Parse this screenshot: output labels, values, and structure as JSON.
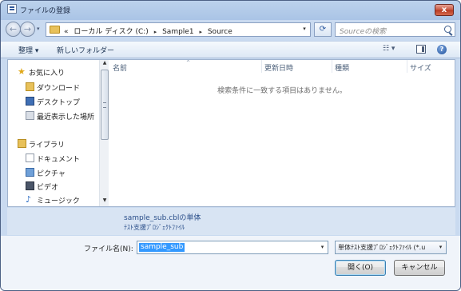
{
  "window": {
    "title": "ファイルの登録",
    "close_glyph": "x"
  },
  "nav": {
    "back_glyph": "←",
    "forward_glyph": "→",
    "dropdown_glyph": "▾",
    "breadcrumb_prefix": "«",
    "breadcrumbs": [
      "ローカル ディスク (C:)",
      "Sample1",
      "Source"
    ],
    "separator_glyph": "▸",
    "refresh_glyph": "⟳",
    "search_placeholder": "Sourceの検索"
  },
  "toolbar": {
    "organize_label": "整理 ▾",
    "new_folder_label": "新しいフォルダー",
    "views_glyph": "☷ ▾",
    "help_glyph": "?"
  },
  "sidebar": {
    "items": [
      {
        "label": "お気に入り",
        "icon": "star-icon"
      },
      {
        "label": "ダウンロード",
        "icon": "downloads-folder-icon"
      },
      {
        "label": "デスクトップ",
        "icon": "desktop-icon"
      },
      {
        "label": "最近表示した場所",
        "icon": "recent-places-icon"
      },
      {
        "label": "ライブラリ",
        "icon": "library-icon"
      },
      {
        "label": "ドキュメント",
        "icon": "documents-icon"
      },
      {
        "label": "ピクチャ",
        "icon": "pictures-icon"
      },
      {
        "label": "ビデオ",
        "icon": "videos-icon"
      },
      {
        "label": "ミュージック",
        "icon": "music-icon"
      }
    ],
    "star_glyph": "★",
    "music_glyph": "♪",
    "scroll_up_glyph": "▲",
    "scroll_down_glyph": "▼"
  },
  "file_list": {
    "columns": [
      "名前",
      "更新日時",
      "種類",
      "サイズ"
    ],
    "sort_glyph": "^",
    "empty_message": "検索条件に一致する項目はありません。"
  },
  "details": {
    "name": "sample_sub.cblの単体",
    "type": "ﾃｽﾄ支援ﾌﾟﾛｼﾞｪｸﾄﾌｧｲﾙ"
  },
  "bottom": {
    "filename_label": "ファイル名(N):",
    "filename_value": "sample_sub",
    "filetype_value": "単体ﾃｽﾄ支援ﾌﾟﾛｼﾞｪｸﾄﾌｧｲﾙ (*.u",
    "open_label": "開く(O)",
    "cancel_label": "キャンセル",
    "dropdown_glyph": "▾"
  },
  "colors": {
    "accent": "#3399ff",
    "title_bar": "#aac4e6",
    "close_button": "#c7553f",
    "link_text": "#2b4f8a"
  }
}
